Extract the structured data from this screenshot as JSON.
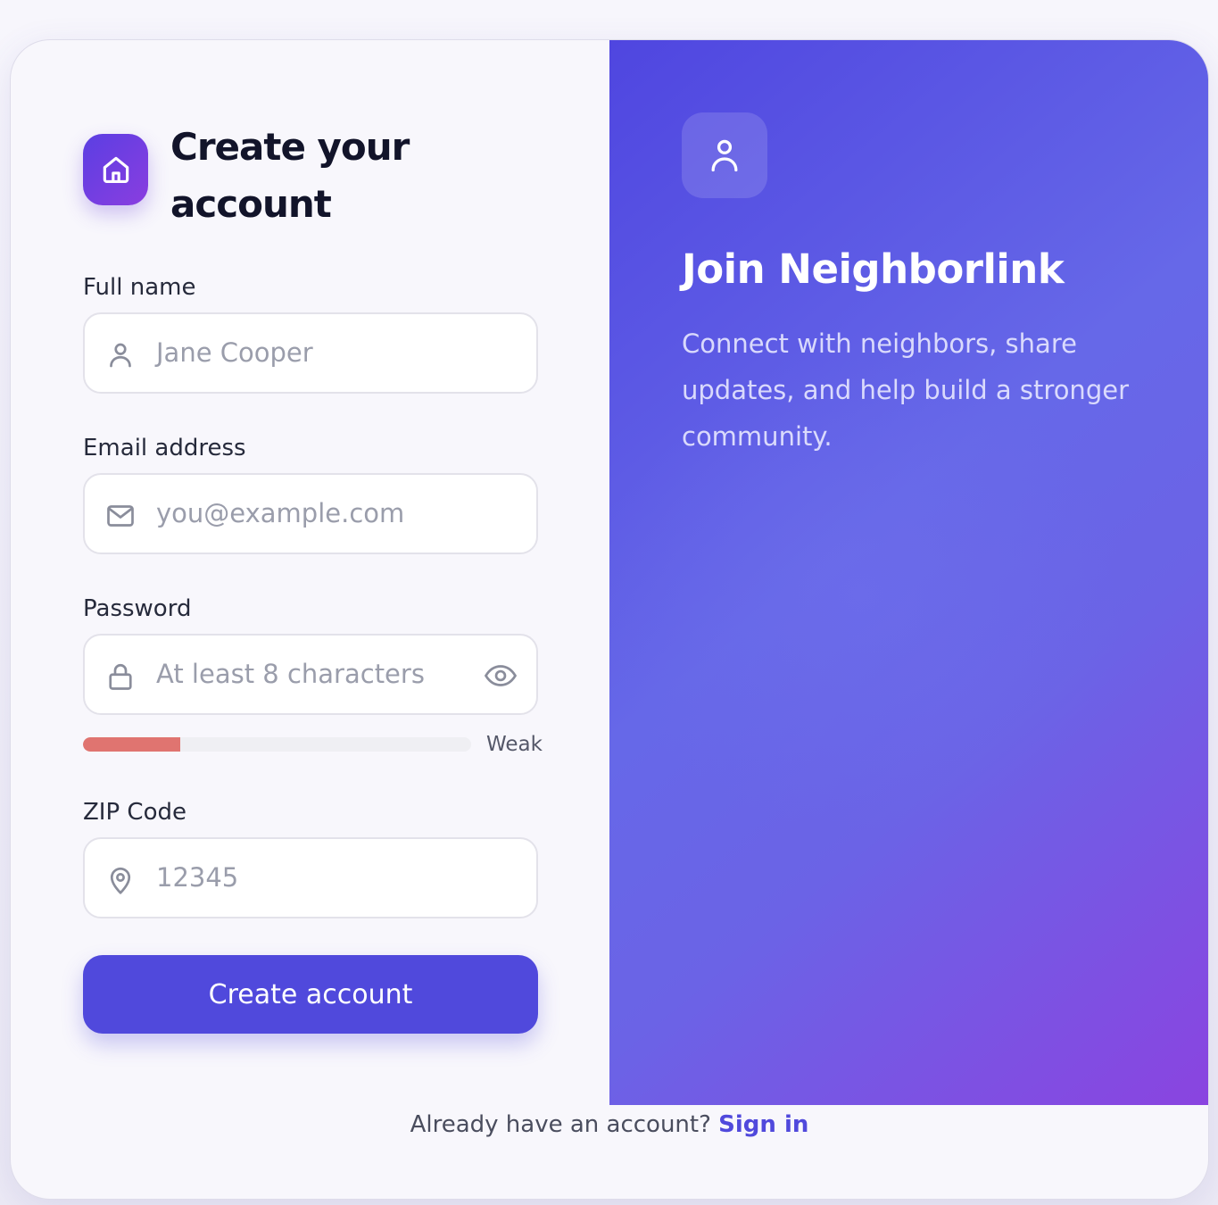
{
  "form": {
    "title": "Create your account",
    "fields": {
      "full_name": {
        "label": "Full name",
        "placeholder": "Jane Cooper",
        "icon": "user-icon"
      },
      "email": {
        "label": "Email address",
        "placeholder": "you@example.com",
        "icon": "mail-icon"
      },
      "password": {
        "label": "Password",
        "placeholder": "At least 8 characters",
        "icon": "lock-icon",
        "toggle_icon": "eye-icon"
      },
      "zip": {
        "label": "ZIP Code",
        "placeholder": "12345",
        "icon": "map-pin-icon"
      }
    },
    "password_strength": {
      "label": "Weak",
      "level": 0.25,
      "color": "#e07470"
    },
    "submit_label": "Create account"
  },
  "promo": {
    "icon": "user-icon",
    "title": "Join Neighborlink",
    "text": "Connect with neighbors, share updates, and help build a stronger community."
  },
  "footer": {
    "prompt": "Already have an account?",
    "link_label": "Sign in"
  },
  "colors": {
    "accent": "#5049dc",
    "gradient_start": "#4f46e0",
    "gradient_end": "#8a44e0",
    "weak": "#e07470"
  }
}
